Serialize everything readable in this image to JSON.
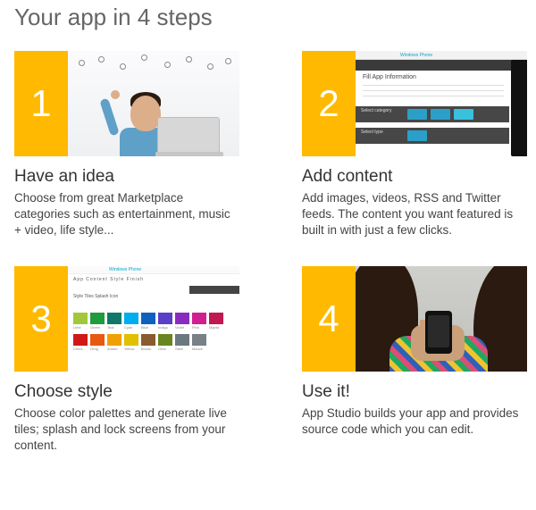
{
  "title": "Your app in 4 steps",
  "accent": "#ffb900",
  "steps": [
    {
      "num": "1",
      "heading": "Have an idea",
      "desc": "Choose from great Marketplace categories such as entertainment, music + video, life style..."
    },
    {
      "num": "2",
      "heading": "Add content",
      "desc": "Add images, videos, RSS and Twitter feeds. The content you want featured is built in with just a few clicks."
    },
    {
      "num": "3",
      "heading": "Choose style",
      "desc": "Choose color palettes and generate live tiles; splash and lock screens from your content."
    },
    {
      "num": "4",
      "heading": "Use it!",
      "desc": "App Studio builds your app and provides source code which you can edit."
    }
  ],
  "il2": {
    "header": "Fill App Information",
    "section1": "Select category",
    "section2": "Select type"
  },
  "il3": {
    "tabs": "Style   Tiles   Splash   Icon",
    "brand": "Windows Phone"
  }
}
